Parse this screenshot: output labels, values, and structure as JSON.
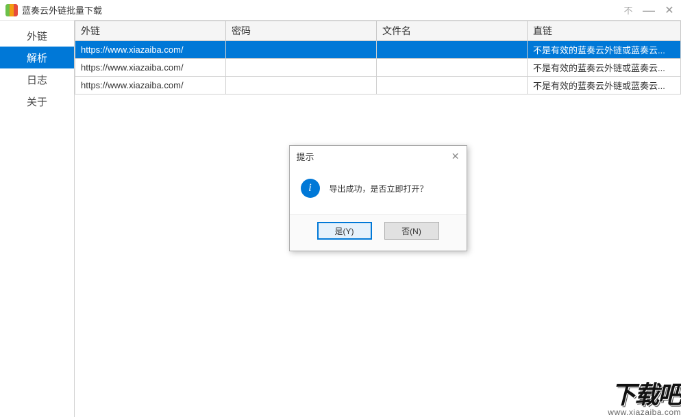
{
  "window": {
    "title": "蓝奏云外链批量下载"
  },
  "sidebar": {
    "items": [
      {
        "label": "外链",
        "active": false
      },
      {
        "label": "解析",
        "active": true
      },
      {
        "label": "日志",
        "active": false
      },
      {
        "label": "关于",
        "active": false
      }
    ]
  },
  "table": {
    "headers": {
      "link": "外链",
      "password": "密码",
      "filename": "文件名",
      "direct": "直链"
    },
    "rows": [
      {
        "link": "https://www.xiazaiba.com/",
        "password": "",
        "filename": "",
        "direct": "不是有效的蓝奏云外链或蓝奏云...",
        "selected": true
      },
      {
        "link": "https://www.xiazaiba.com/",
        "password": "",
        "filename": "",
        "direct": "不是有效的蓝奏云外链或蓝奏云...",
        "selected": false
      },
      {
        "link": "https://www.xiazaiba.com/",
        "password": "",
        "filename": "",
        "direct": "不是有效的蓝奏云外链或蓝奏云...",
        "selected": false
      }
    ]
  },
  "dialog": {
    "title": "提示",
    "message": "导出成功，是否立即打开？",
    "yes": "是(Y)",
    "no": "否(N)"
  },
  "watermark": {
    "big": "下载吧",
    "url": "www.xiazaiba.com"
  }
}
